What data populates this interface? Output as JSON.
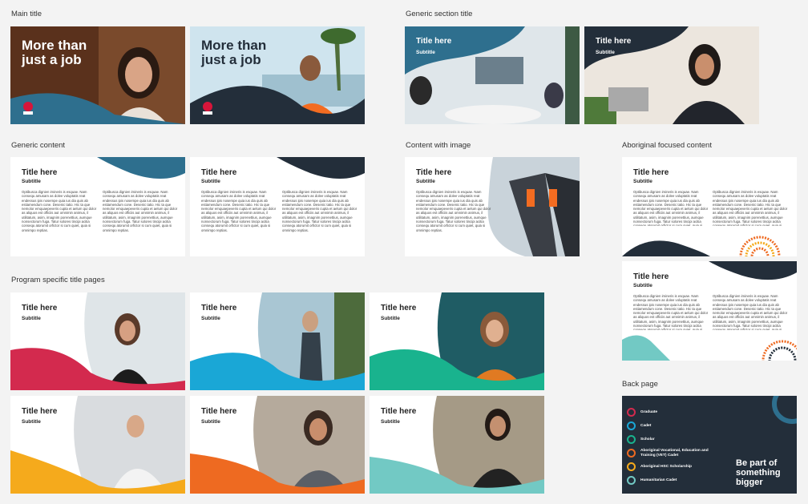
{
  "sections": {
    "main_title": "Main title",
    "generic_section_title": "Generic section title",
    "generic_content": "Generic content",
    "content_with_image": "Content with image",
    "aboriginal_focused": "Aboriginal focused content",
    "program_specific": "Program specific title pages",
    "back_page": "Back page"
  },
  "main_title_slides": [
    {
      "headline_1": "More than",
      "headline_2": "just a job",
      "logo": "nsw-waratah-logo"
    },
    {
      "headline_1": "More than",
      "headline_2": "just a job",
      "logo": "nsw-waratah-logo"
    }
  ],
  "placeholder": {
    "title": "Title here",
    "subtitle": "Subtitle",
    "body_left": "Optibusca dignien imineris is esquae. Nam consequ amusam as dolee voluptatis reat endessus ipis nosempe quia ius dia quis ab estiamendum cone. Desenic tatio. Hic ta que nemolor emquaepeveris cupta et aelum qui dolor as aliquos est officiis aut omnimin animus, il utilitatum, asim, imagnim porenettius, aumque nonsectorum fuga. Tatur solores tincipi acitia consequ atorumit orfictor si cum quiet, quia si omnimpo reptias.",
    "body_right": "Optibusca dignien imineris is esquae. Nam consequ amusam as dolee voluptatis reat endessus ipis nosempe quia ius dia quis ab estiamendum cone. Desenic tatio. Hic ta que nemolor emquaepeveris cupta et aelum qui dolor as aliquos est officiis aut omnimin animus, il utilitatum, asim, imagnim porenettius, aumque nonsectorum fuga. Tatur solores tincipi acitia consequ atorumit orfictor si cum quiet, quia si omnimpo reptias."
  },
  "back_page": {
    "items": [
      "Graduate",
      "Cadet",
      "Scholar",
      "Aboriginal Vocational, Education and Training (VET) Cadet",
      "Aboriginal HSC Scholarship",
      "Humanitarian Cadet"
    ],
    "tagline_1": "Be part of",
    "tagline_2": "something",
    "tagline_3": "bigger"
  },
  "colors": {
    "teal_blue": "#2e6f8e",
    "navy": "#232e3a",
    "crimson": "#d32a4e",
    "sky": "#1aa7d6",
    "green": "#19b38e",
    "yellow": "#f5aa1c",
    "orange": "#ee6a21",
    "aqua": "#72c9c4"
  }
}
